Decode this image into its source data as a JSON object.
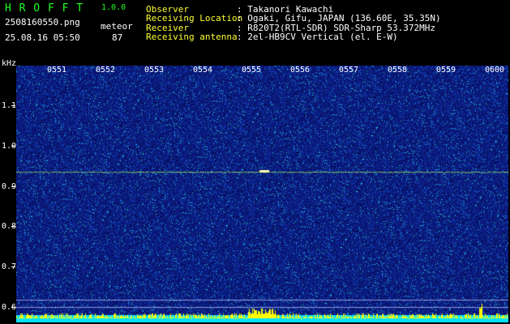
{
  "header": {
    "app_name": "H R O F F T",
    "version": "1.0.0",
    "filename": "2508160550.png",
    "datetime": "25.08.16 05:50",
    "mode": "meteor",
    "count": "87",
    "info_rows": [
      {
        "label": "Observer",
        "value": ": Takanori Kawachi"
      },
      {
        "label": "Receiving Location",
        "value": ": Ogaki, Gifu, JAPAN (136.60E, 35.35N)"
      },
      {
        "label": "Receiver",
        "value": ": R820T2(RTL-SDR) SDR-Sharp 53.372MHz"
      },
      {
        "label": "Receiving antenna",
        "value": ": 2el-HB9CV Vertical (el. E-W)"
      }
    ]
  },
  "spectrogram": {
    "y_unit": "kHz",
    "y_labels": [
      "1.1",
      "1.0",
      "0.9",
      "0.8",
      "0.7",
      "0.6"
    ],
    "time_labels": [
      "0551",
      "0552",
      "0553",
      "0554",
      "0555",
      "0556",
      "0557",
      "0558",
      "0559",
      "0600"
    ],
    "colors": {
      "background": "#0a1878",
      "carrier": "#aaff66",
      "level_bar": "#ffff00"
    }
  }
}
